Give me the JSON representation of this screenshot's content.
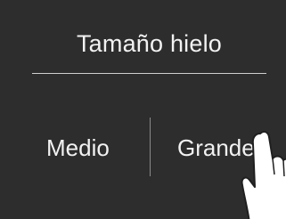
{
  "panel": {
    "title": "Tamaño hielo",
    "options": [
      {
        "label": "Medio"
      },
      {
        "label": "Grande"
      }
    ]
  },
  "overlay": {
    "icon": "pointing-hand-icon"
  },
  "colors": {
    "background": "#2d2d2d",
    "text": "#f2f2f2",
    "divider": "#cfcfcf"
  }
}
